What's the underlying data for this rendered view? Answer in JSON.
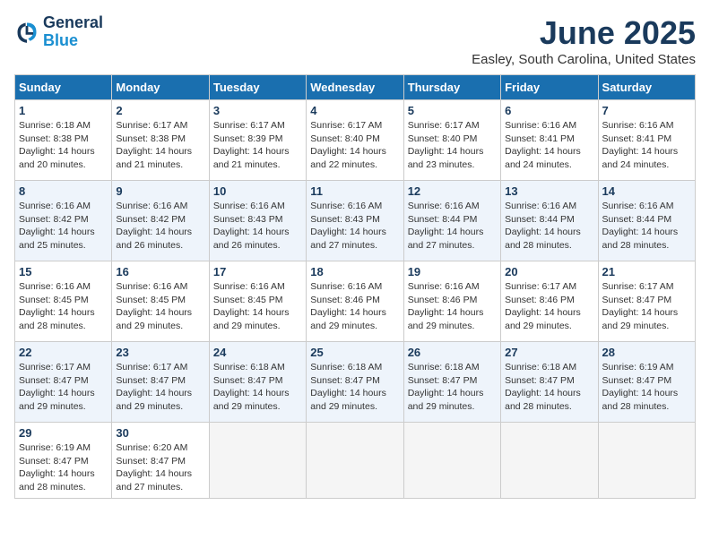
{
  "header": {
    "logo_line1": "General",
    "logo_line2": "Blue",
    "month": "June 2025",
    "location": "Easley, South Carolina, United States"
  },
  "days_of_week": [
    "Sunday",
    "Monday",
    "Tuesday",
    "Wednesday",
    "Thursday",
    "Friday",
    "Saturday"
  ],
  "weeks": [
    [
      {
        "day": "1",
        "sunrise": "6:18 AM",
        "sunset": "8:38 PM",
        "daylight": "14 hours and 20 minutes."
      },
      {
        "day": "2",
        "sunrise": "6:17 AM",
        "sunset": "8:38 PM",
        "daylight": "14 hours and 21 minutes."
      },
      {
        "day": "3",
        "sunrise": "6:17 AM",
        "sunset": "8:39 PM",
        "daylight": "14 hours and 21 minutes."
      },
      {
        "day": "4",
        "sunrise": "6:17 AM",
        "sunset": "8:40 PM",
        "daylight": "14 hours and 22 minutes."
      },
      {
        "day": "5",
        "sunrise": "6:17 AM",
        "sunset": "8:40 PM",
        "daylight": "14 hours and 23 minutes."
      },
      {
        "day": "6",
        "sunrise": "6:16 AM",
        "sunset": "8:41 PM",
        "daylight": "14 hours and 24 minutes."
      },
      {
        "day": "7",
        "sunrise": "6:16 AM",
        "sunset": "8:41 PM",
        "daylight": "14 hours and 24 minutes."
      }
    ],
    [
      {
        "day": "8",
        "sunrise": "6:16 AM",
        "sunset": "8:42 PM",
        "daylight": "14 hours and 25 minutes."
      },
      {
        "day": "9",
        "sunrise": "6:16 AM",
        "sunset": "8:42 PM",
        "daylight": "14 hours and 26 minutes."
      },
      {
        "day": "10",
        "sunrise": "6:16 AM",
        "sunset": "8:43 PM",
        "daylight": "14 hours and 26 minutes."
      },
      {
        "day": "11",
        "sunrise": "6:16 AM",
        "sunset": "8:43 PM",
        "daylight": "14 hours and 27 minutes."
      },
      {
        "day": "12",
        "sunrise": "6:16 AM",
        "sunset": "8:44 PM",
        "daylight": "14 hours and 27 minutes."
      },
      {
        "day": "13",
        "sunrise": "6:16 AM",
        "sunset": "8:44 PM",
        "daylight": "14 hours and 28 minutes."
      },
      {
        "day": "14",
        "sunrise": "6:16 AM",
        "sunset": "8:44 PM",
        "daylight": "14 hours and 28 minutes."
      }
    ],
    [
      {
        "day": "15",
        "sunrise": "6:16 AM",
        "sunset": "8:45 PM",
        "daylight": "14 hours and 28 minutes."
      },
      {
        "day": "16",
        "sunrise": "6:16 AM",
        "sunset": "8:45 PM",
        "daylight": "14 hours and 29 minutes."
      },
      {
        "day": "17",
        "sunrise": "6:16 AM",
        "sunset": "8:45 PM",
        "daylight": "14 hours and 29 minutes."
      },
      {
        "day": "18",
        "sunrise": "6:16 AM",
        "sunset": "8:46 PM",
        "daylight": "14 hours and 29 minutes."
      },
      {
        "day": "19",
        "sunrise": "6:16 AM",
        "sunset": "8:46 PM",
        "daylight": "14 hours and 29 minutes."
      },
      {
        "day": "20",
        "sunrise": "6:17 AM",
        "sunset": "8:46 PM",
        "daylight": "14 hours and 29 minutes."
      },
      {
        "day": "21",
        "sunrise": "6:17 AM",
        "sunset": "8:47 PM",
        "daylight": "14 hours and 29 minutes."
      }
    ],
    [
      {
        "day": "22",
        "sunrise": "6:17 AM",
        "sunset": "8:47 PM",
        "daylight": "14 hours and 29 minutes."
      },
      {
        "day": "23",
        "sunrise": "6:17 AM",
        "sunset": "8:47 PM",
        "daylight": "14 hours and 29 minutes."
      },
      {
        "day": "24",
        "sunrise": "6:18 AM",
        "sunset": "8:47 PM",
        "daylight": "14 hours and 29 minutes."
      },
      {
        "day": "25",
        "sunrise": "6:18 AM",
        "sunset": "8:47 PM",
        "daylight": "14 hours and 29 minutes."
      },
      {
        "day": "26",
        "sunrise": "6:18 AM",
        "sunset": "8:47 PM",
        "daylight": "14 hours and 29 minutes."
      },
      {
        "day": "27",
        "sunrise": "6:18 AM",
        "sunset": "8:47 PM",
        "daylight": "14 hours and 28 minutes."
      },
      {
        "day": "28",
        "sunrise": "6:19 AM",
        "sunset": "8:47 PM",
        "daylight": "14 hours and 28 minutes."
      }
    ],
    [
      {
        "day": "29",
        "sunrise": "6:19 AM",
        "sunset": "8:47 PM",
        "daylight": "14 hours and 28 minutes."
      },
      {
        "day": "30",
        "sunrise": "6:20 AM",
        "sunset": "8:47 PM",
        "daylight": "14 hours and 27 minutes."
      },
      null,
      null,
      null,
      null,
      null
    ]
  ]
}
